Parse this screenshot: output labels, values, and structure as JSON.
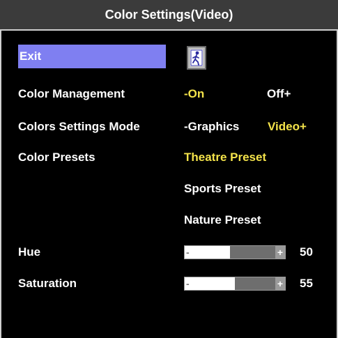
{
  "title": "Color Settings(Video)",
  "exit": {
    "label": "Exit",
    "icon": "exit-figure-icon"
  },
  "color_management": {
    "label": "Color Management",
    "on": "-On",
    "off": "Off+"
  },
  "colors_settings_mode": {
    "label": "Colors Settings Mode",
    "graphics": "-Graphics",
    "video": "Video+"
  },
  "color_presets": {
    "label": "Color Presets",
    "options": [
      "Theatre Preset",
      "Sports Preset",
      "Nature Preset"
    ]
  },
  "hue": {
    "label": "Hue",
    "value": "50",
    "level": 50
  },
  "saturation": {
    "label": "Saturation",
    "value": "55",
    "level": 55
  },
  "colors": {
    "background": "#000000",
    "title_bar": "#3b3b3b",
    "exit_highlight": "#7f7ff1",
    "selected_text": "#f4e34a",
    "slider_track": "#6e6e6e"
  }
}
